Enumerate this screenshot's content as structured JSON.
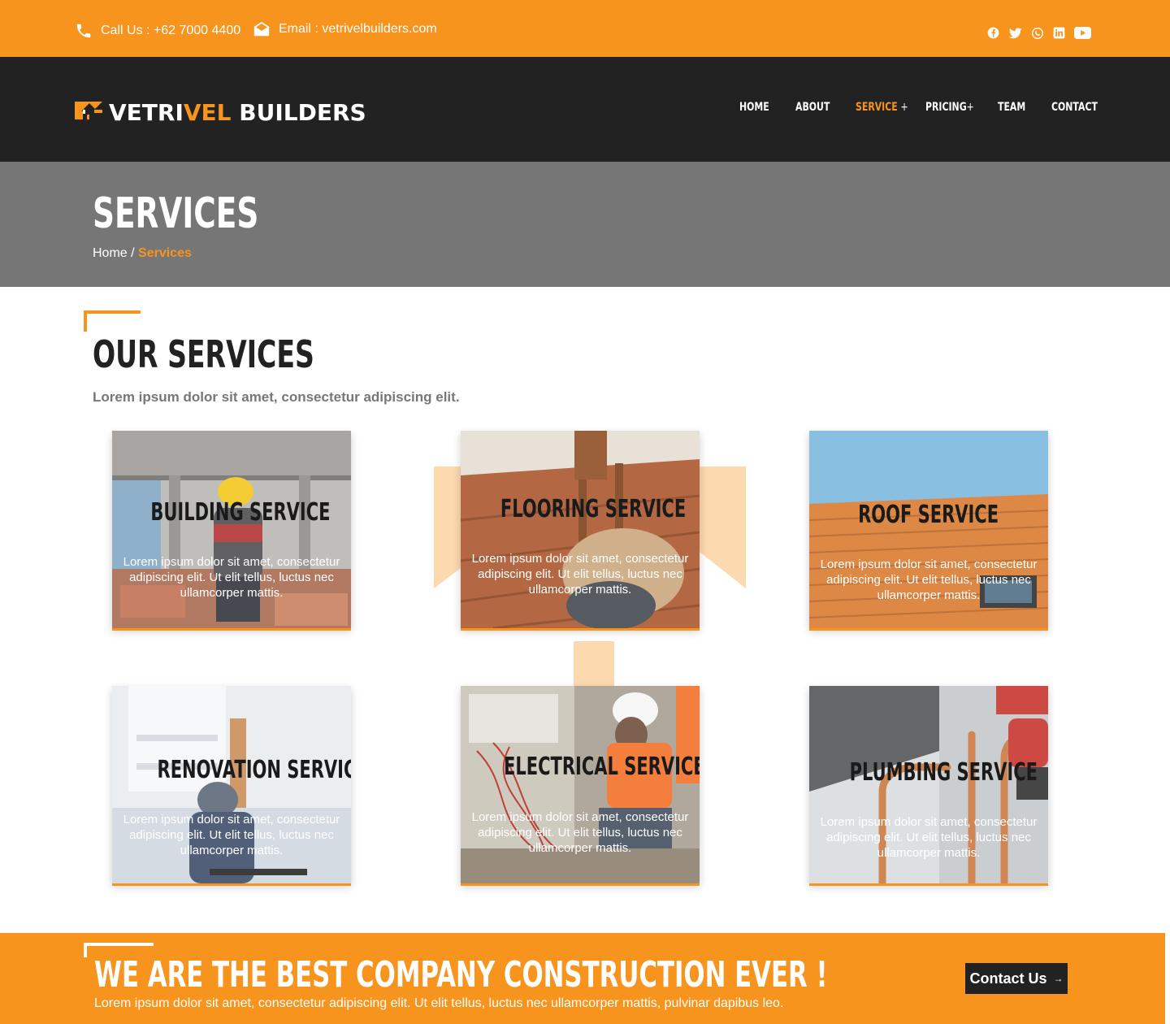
{
  "topbar": {
    "phone": "Call Us : +62 7000 4400",
    "email": "Email : vetrivelbuilders.com",
    "social_icons": [
      "facebook-icon",
      "twitter-icon",
      "whatsapp-icon",
      "linkedin-icon",
      "youtube-icon"
    ]
  },
  "logo": {
    "part1": "VETRI",
    "part2": "VEL",
    "part3": " BUILDERS"
  },
  "nav": {
    "home": "HOME",
    "about": "ABOUT",
    "service": "SERVICE",
    "service_plus": "+",
    "pricing": "PRICING",
    "pricing_plus": "+",
    "team": "TEAM",
    "contact": "CONTACT"
  },
  "banner": {
    "title": "SERVICES",
    "crumb_home": "Home",
    "crumb_sep": " / ",
    "crumb_current": "Services"
  },
  "services_section": {
    "title": "OUR SERVICES",
    "subtitle": "Lorem ipsum dolor sit amet, consectetur adipiscing elit."
  },
  "services": [
    {
      "title": "BUILDING SERVICE",
      "text": "Lorem ipsum dolor sit amet, consectetur adipiscing elit. Ut elit tellus, luctus nec ullamcorper mattis."
    },
    {
      "title": "FLOORING SERVICE",
      "text": "Lorem ipsum dolor sit amet, consectetur adipiscing elit. Ut elit tellus, luctus nec ullamcorper mattis."
    },
    {
      "title": "ROOF SERVICE",
      "text": "Lorem ipsum dolor sit amet, consectetur adipiscing elit. Ut elit tellus, luctus nec ullamcorper mattis."
    },
    {
      "title": "RENOVATION SERVICE",
      "text": "Lorem ipsum dolor sit amet, consectetur adipiscing elit. Ut elit tellus, luctus nec ullamcorper mattis."
    },
    {
      "title": "ELECTRICAL SERVICE",
      "text": "Lorem ipsum dolor sit amet, consectetur adipiscing elit. Ut elit tellus, luctus nec ullamcorper mattis."
    },
    {
      "title": "PLUMBING SERVICE",
      "text": "Lorem ipsum dolor sit amet, consectetur adipiscing elit. Ut elit tellus, luctus nec ullamcorper mattis."
    }
  ],
  "cta": {
    "title": "WE ARE THE BEST COMPANY CONSTRUCTION EVER !",
    "text": "Lorem ipsum dolor sit amet, consectetur adipiscing elit. Ut elit tellus, luctus nec ullamcorper mattis, pulvinar dapibus leo.",
    "button": "Contact Us",
    "button_arrow": "→"
  },
  "colors": {
    "accent": "#f7941d",
    "dark": "#222222",
    "banner": "#767676",
    "deco": "#fdd9b0"
  }
}
